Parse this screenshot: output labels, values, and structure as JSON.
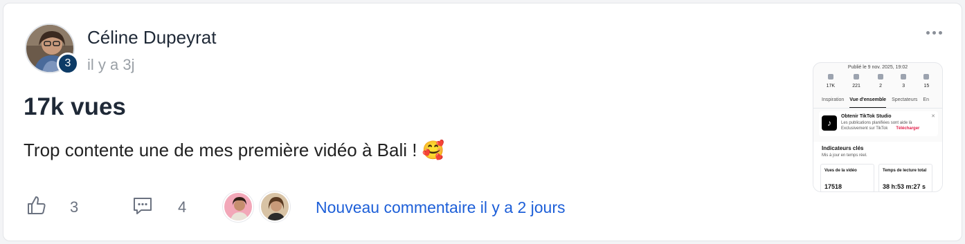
{
  "post": {
    "author": "Céline Dupeyrat",
    "badge": "3",
    "time": "il y a 3j",
    "title": "17k vues",
    "body": "Trop contente une de mes première vidéo à Bali ! 🥰"
  },
  "actions": {
    "likes": "3",
    "comments": "4",
    "new_comment": "Nouveau commentaire il y a 2 jours"
  },
  "thumbnail": {
    "published": "Publié le 9 nov. 2025, 19:02",
    "stats": [
      {
        "icon": "play-icon",
        "value": "17K"
      },
      {
        "icon": "heart-icon",
        "value": "221"
      },
      {
        "icon": "comment-icon",
        "value": "2"
      },
      {
        "icon": "share-icon",
        "value": "3"
      },
      {
        "icon": "bookmark-icon",
        "value": "15"
      }
    ],
    "tabs": [
      "Inspiration",
      "Vue d'ensemble",
      "Spectateurs",
      "En"
    ],
    "studio_title": "Obtenir TikTok Studio",
    "studio_line1": "Les publications planifiées sont aide là",
    "studio_line2": "Exclusivement sur TikTok",
    "studio_download": "Télécharger",
    "kpi_title": "Indicateurs clés",
    "kpi_sub": "Mis à jour en temps réel.",
    "views_label": "Vues de la vidéo",
    "views_value": "17518",
    "watch_label": "Temps de lecture total",
    "watch_value": "38 h:53 m:27 s"
  },
  "colors": {
    "accent": "#1d5fd8",
    "badge": "#0d3b66"
  }
}
